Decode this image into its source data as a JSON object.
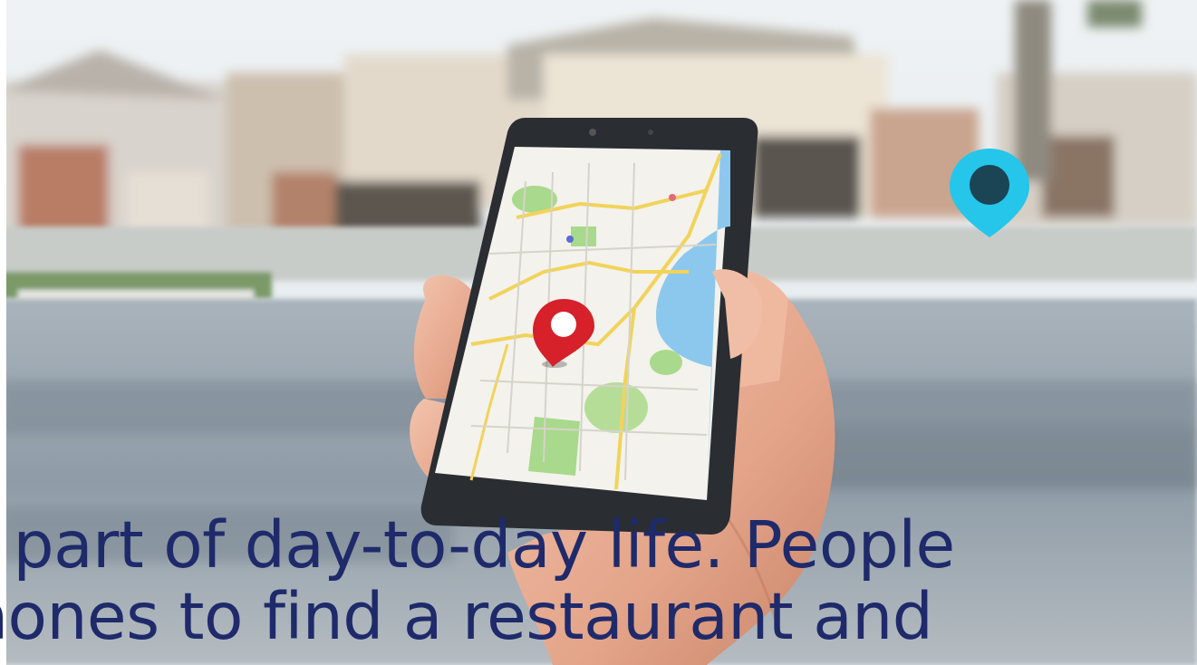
{
  "scene": {
    "description_tags": [
      "photo-background",
      "hand-holding-phone",
      "map-app"
    ],
    "icons": [
      "map-pin-red",
      "map-pin-cyan"
    ],
    "colors": {
      "caption": "#1f2a6b",
      "pin_red": "#d6202a",
      "pin_cyan": "#25c6ea",
      "sky": "#e9eef3",
      "road": "#8a97a3",
      "phone_body": "#2a2d31",
      "map_bg": "#f3f2ec",
      "map_water": "#8cc8ee",
      "map_park": "#a9d98c",
      "map_road_yellow": "#f2d35a"
    }
  },
  "caption": {
    "line1": "s part of day-to-day life. People",
    "line2": "hones to find a restaurant and"
  }
}
